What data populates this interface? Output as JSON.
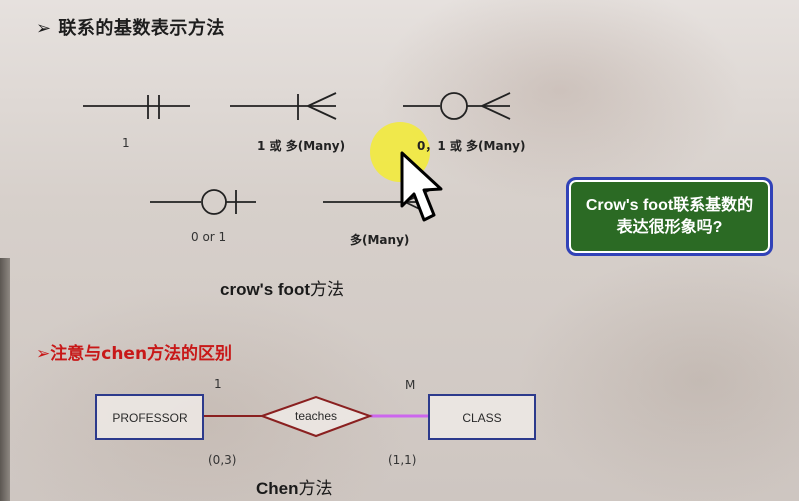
{
  "slide": {
    "title": "➢ 联系的基数表示方法",
    "crowsfoot": {
      "labels": [
        "1",
        "1 或 多(Many)",
        "0，1 或 多(Many)",
        "0 or 1",
        "多(Many)"
      ],
      "caption_bold": "crow's foot",
      "caption_rest": "方法"
    },
    "callout": "Crow's foot联系基数的表达很形象吗?",
    "subtitle": "➢注意与chen方法的区别",
    "chen": {
      "left_entity": "PROFESSOR",
      "relationship": "teaches",
      "right_entity": "CLASS",
      "left_cardinality": "1",
      "right_cardinality": "M",
      "left_participation": "(0,3)",
      "right_participation": "(1,1)",
      "caption_bold": "Chen",
      "caption_rest": "方法"
    }
  },
  "colors": {
    "title": "#1d1d1d",
    "subtitle": "#c81818",
    "callout_fill": "#2b6a24",
    "callout_border": "#3142b8",
    "entity_border": "#2c3a8c",
    "relationship_border": "#8a2020",
    "highlight": "#f2ea3c",
    "highlight_line": "#cc66ee"
  },
  "icons": {
    "cursor": "mouse-pointer-icon",
    "highlight": "cursor-highlight-icon"
  }
}
